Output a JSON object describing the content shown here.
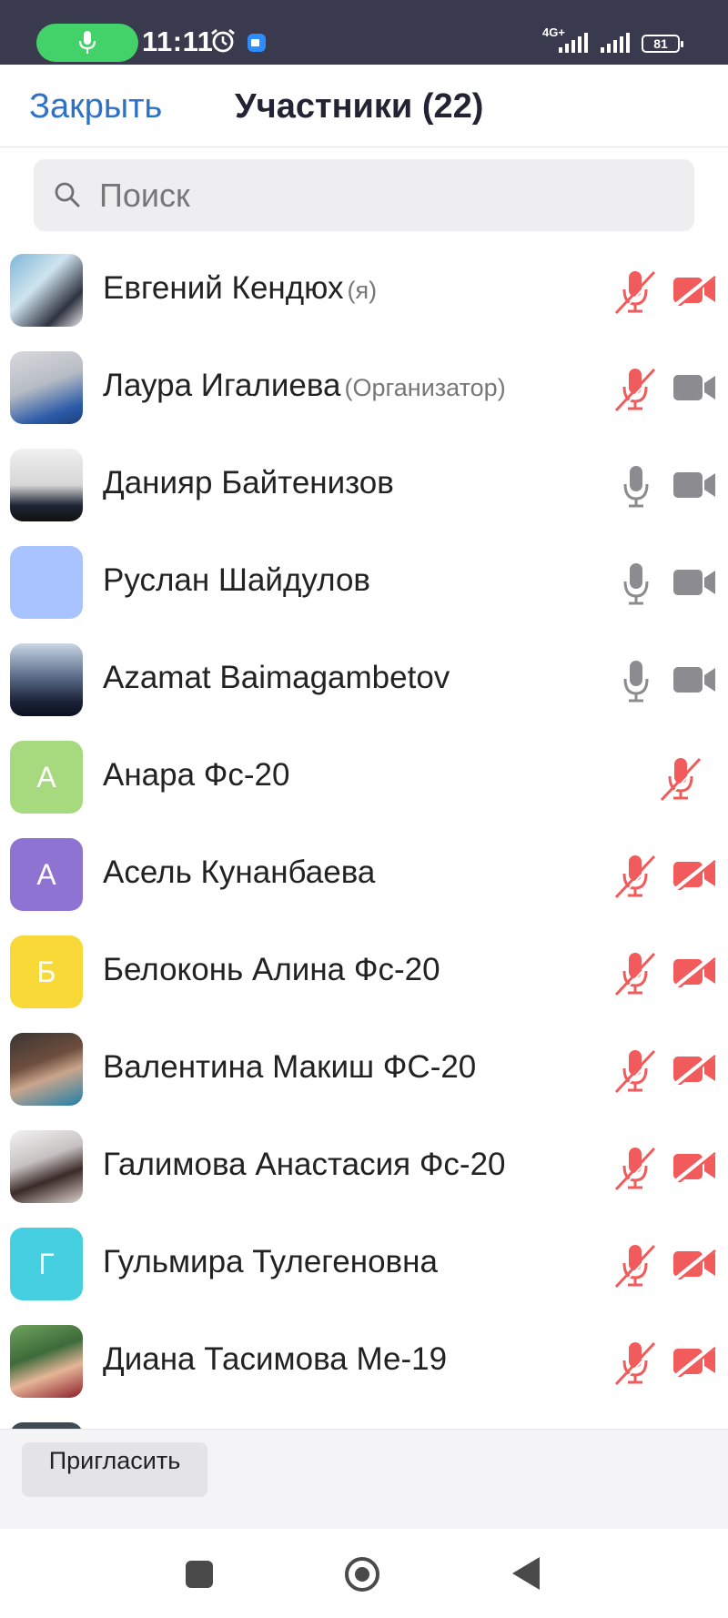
{
  "status_bar": {
    "time": "11:11",
    "network": "4G+",
    "battery": "81",
    "icons": [
      "microphone-icon",
      "alarm-icon",
      "zoom-app-icon",
      "signal-icon",
      "battery-icon"
    ]
  },
  "header": {
    "close_label": "Закрыть",
    "title": "Участники (22)"
  },
  "search": {
    "placeholder": "Поиск",
    "value": ""
  },
  "participants": [
    {
      "name": "Евгений Кендюх",
      "tag": "(я)",
      "avatar": "photo",
      "mic": "muted",
      "video": "off"
    },
    {
      "name": "Лаура Игалиева",
      "tag": "(Организатор)",
      "avatar": "photo",
      "mic": "muted",
      "video": "on"
    },
    {
      "name": "Данияр Байтенизов",
      "tag": "",
      "avatar": "photo",
      "mic": "on",
      "video": "on"
    },
    {
      "name": "Руслан Шайдулов",
      "tag": "",
      "avatar": "",
      "avatar_color": "#a9c3ff",
      "mic": "on",
      "video": "on"
    },
    {
      "name": "Azamat Baimagambetov",
      "tag": "",
      "avatar": "photo",
      "mic": "on",
      "video": "on"
    },
    {
      "name": "Анара Фс-20",
      "tag": "",
      "avatar": "А",
      "avatar_color": "#a7d97f",
      "mic": "muted",
      "video": "none"
    },
    {
      "name": "Асель Кунанбаева",
      "tag": "",
      "avatar": "А",
      "avatar_color": "#8f73d2",
      "mic": "muted",
      "video": "off"
    },
    {
      "name": "Белоконь Алина Фс-20",
      "tag": "",
      "avatar": "Б",
      "avatar_color": "#f9d938",
      "mic": "muted",
      "video": "off"
    },
    {
      "name": "Валентина Макиш ФС-20",
      "tag": "",
      "avatar": "photo",
      "mic": "muted",
      "video": "off"
    },
    {
      "name": "Галимова Анастасия Фс-20",
      "tag": "",
      "avatar": "photo",
      "mic": "muted",
      "video": "off"
    },
    {
      "name": "Гульмира Тулегеновна",
      "tag": "",
      "avatar": "Г",
      "avatar_color": "#45cfe0",
      "mic": "muted",
      "video": "off"
    },
    {
      "name": "Диана Тасимова Ме-19",
      "tag": "",
      "avatar": "photo",
      "mic": "muted",
      "video": "off"
    }
  ],
  "bottom": {
    "invite_label": "Пригласить"
  },
  "colors": {
    "accent": "#2d72c8",
    "muted_red": "#f25b5b",
    "icon_gray": "#8c8c90",
    "status_bar": "#3a3a4e"
  }
}
